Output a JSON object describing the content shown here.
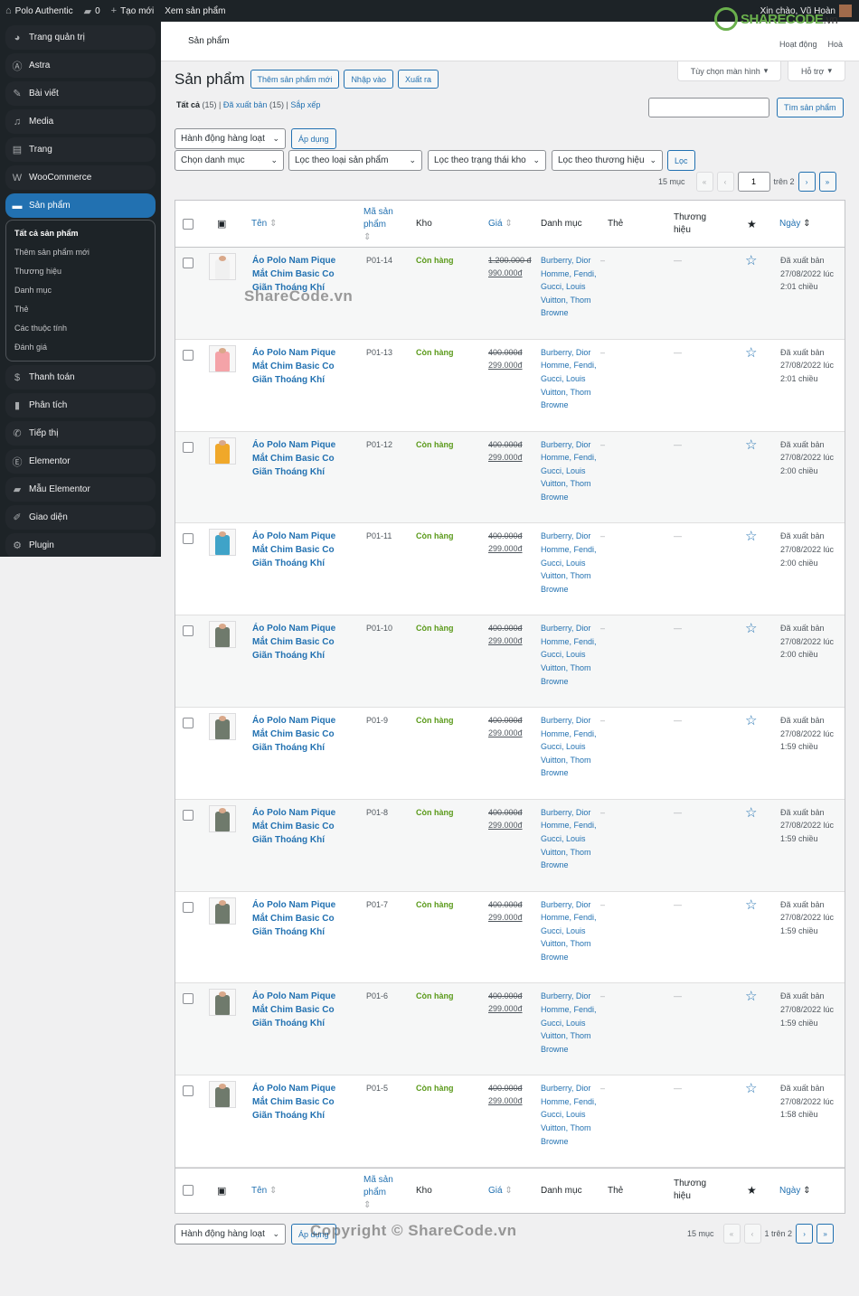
{
  "adminbar": {
    "site": "Polo Authentic",
    "comments": "0",
    "new": "Tạo mới",
    "view": "Xem sản phẩm",
    "greeting": "Xin chào, Vũ Hoàn"
  },
  "sidebar": {
    "items": [
      {
        "label": "Trang quản trị",
        "icon": "dashboard-icon",
        "g": "◕"
      },
      {
        "label": "Astra",
        "icon": "astra-icon",
        "g": "Ⓐ"
      },
      {
        "label": "Bài viết",
        "icon": "pin-icon",
        "g": "✎"
      },
      {
        "label": "Media",
        "icon": "media-icon",
        "g": "♫"
      },
      {
        "label": "Trang",
        "icon": "pages-icon",
        "g": "▤"
      },
      {
        "label": "WooCommerce",
        "icon": "woo-icon",
        "g": "W"
      },
      {
        "label": "Sản phẩm",
        "icon": "products-icon",
        "g": "▬"
      }
    ],
    "submenu": [
      "Tất cả sản phẩm",
      "Thêm sản phẩm mới",
      "Thương hiệu",
      "Danh mục",
      "Thẻ",
      "Các thuộc tính",
      "Đánh giá"
    ],
    "items2": [
      {
        "label": "Thanh toán",
        "icon": "payments-icon",
        "g": "$"
      },
      {
        "label": "Phân tích",
        "icon": "analytics-icon",
        "g": "▮"
      },
      {
        "label": "Tiếp thị",
        "icon": "megaphone-icon",
        "g": "✆"
      },
      {
        "label": "Elementor",
        "icon": "elementor-icon",
        "g": "Ⓔ"
      },
      {
        "label": "Mẫu Elementor",
        "icon": "folder-icon",
        "g": "▰"
      },
      {
        "label": "Giao diện",
        "icon": "brush-icon",
        "g": "✐"
      },
      {
        "label": "Plugin",
        "icon": "plugin-icon",
        "g": "⚙"
      }
    ]
  },
  "header": {
    "title": "Sản phẩm",
    "activity": "Hoạt động",
    "activity2": "Hoà",
    "screen_options": "Tùy chọn màn hình",
    "help": "Hỗ trợ",
    "logo": "SHARECODE",
    "logo_tld": ".vn"
  },
  "page": {
    "title": "Sản phẩm",
    "add_new": "Thêm sản phẩm mới",
    "import": "Nhập vào",
    "export": "Xuất ra",
    "views": {
      "all": "Tất cả",
      "all_count": "(15)",
      "published": "Đã xuất bản",
      "published_count": "(15)",
      "sort": "Sắp xếp"
    },
    "search_button": "Tìm sản phẩm",
    "search_value": ""
  },
  "filters": {
    "bulk": "Hành động hàng loạt",
    "apply": "Áp dụng",
    "category": "Chọn danh mục",
    "type": "Lọc theo loại sản phẩm",
    "stock": "Lọc theo trạng thái kho",
    "brand": "Lọc theo thương hiệu",
    "filter": "Lọc"
  },
  "pagination": {
    "count": "15 mục",
    "current": "1",
    "of": "trên 2",
    "first": "«",
    "prev": "‹",
    "next": "›",
    "last": "»",
    "bottom_text": "1 trên 2"
  },
  "columns": {
    "name": "Tên",
    "sku1": "Mã sản",
    "sku2": "phẩm",
    "stock": "Kho",
    "price": "Giá",
    "categories": "Danh mục",
    "tags": "Thẻ",
    "brand1": "Thương",
    "brand2": "hiệu",
    "date": "Ngày"
  },
  "products": [
    {
      "name": "Áo Polo Nam Pique Mắt Chim Basic Co Giãn Thoáng Khí",
      "sku": "P01-14",
      "stock": "Còn hàng",
      "old": "1.200.000 đ",
      "new": "990.000đ",
      "cats": "Burberry, Dior Homme, Fendi, Gucci, Louis Vuitton, Thom Browne",
      "tags": "–",
      "brand": "—",
      "status": "Đã xuất bản",
      "date": "27/08/2022 lúc 2:01 chiều",
      "color": "#f0f0f0"
    },
    {
      "name": "Áo Polo Nam Pique Mắt Chim Basic Co Giãn Thoáng Khí",
      "sku": "P01-13",
      "stock": "Còn hàng",
      "old": "400.000đ",
      "new": "299.000đ",
      "cats": "Burberry, Dior Homme, Fendi, Gucci, Louis Vuitton, Thom Browne",
      "tags": "–",
      "brand": "—",
      "status": "Đã xuất bản",
      "date": "27/08/2022 lúc 2:01 chiều",
      "color": "#f4a3a8"
    },
    {
      "name": "Áo Polo Nam Pique Mắt Chim Basic Co Giãn Thoáng Khí",
      "sku": "P01-12",
      "stock": "Còn hàng",
      "old": "400.000đ",
      "new": "299.000đ",
      "cats": "Burberry, Dior Homme, Fendi, Gucci, Louis Vuitton, Thom Browne",
      "tags": "–",
      "brand": "—",
      "status": "Đã xuất bản",
      "date": "27/08/2022 lúc 2:00 chiều",
      "color": "#f0a82a"
    },
    {
      "name": "Áo Polo Nam Pique Mắt Chim Basic Co Giãn Thoáng Khí",
      "sku": "P01-11",
      "stock": "Còn hàng",
      "old": "400.000đ",
      "new": "299.000đ",
      "cats": "Burberry, Dior Homme, Fendi, Gucci, Louis Vuitton, Thom Browne",
      "tags": "–",
      "brand": "—",
      "status": "Đã xuất bản",
      "date": "27/08/2022 lúc 2:00 chiều",
      "color": "#3fa3c8"
    },
    {
      "name": "Áo Polo Nam Pique Mắt Chim Basic Co Giãn Thoáng Khí",
      "sku": "P01-10",
      "stock": "Còn hàng",
      "old": "400.000đ",
      "new": "299.000đ",
      "cats": "Burberry, Dior Homme, Fendi, Gucci, Louis Vuitton, Thom Browne",
      "tags": "–",
      "brand": "—",
      "status": "Đã xuất bản",
      "date": "27/08/2022 lúc 2:00 chiều",
      "color": "#6f7a6c"
    },
    {
      "name": "Áo Polo Nam Pique Mắt Chim Basic Co Giãn Thoáng Khí",
      "sku": "P01-9",
      "stock": "Còn hàng",
      "old": "400.000đ",
      "new": "299.000đ",
      "cats": "Burberry, Dior Homme, Fendi, Gucci, Louis Vuitton, Thom Browne",
      "tags": "–",
      "brand": "—",
      "status": "Đã xuất bản",
      "date": "27/08/2022 lúc 1:59 chiều",
      "color": "#6f7a6c"
    },
    {
      "name": "Áo Polo Nam Pique Mắt Chim Basic Co Giãn Thoáng Khí",
      "sku": "P01-8",
      "stock": "Còn hàng",
      "old": "400.000đ",
      "new": "299.000đ",
      "cats": "Burberry, Dior Homme, Fendi, Gucci, Louis Vuitton, Thom Browne",
      "tags": "–",
      "brand": "—",
      "status": "Đã xuất bản",
      "date": "27/08/2022 lúc 1:59 chiều",
      "color": "#6f7a6c"
    },
    {
      "name": "Áo Polo Nam Pique Mắt Chim Basic Co Giãn Thoáng Khí",
      "sku": "P01-7",
      "stock": "Còn hàng",
      "old": "400.000đ",
      "new": "299.000đ",
      "cats": "Burberry, Dior Homme, Fendi, Gucci, Louis Vuitton, Thom Browne",
      "tags": "–",
      "brand": "—",
      "status": "Đã xuất bản",
      "date": "27/08/2022 lúc 1:59 chiều",
      "color": "#6f7a6c"
    },
    {
      "name": "Áo Polo Nam Pique Mắt Chim Basic Co Giãn Thoáng Khí",
      "sku": "P01-6",
      "stock": "Còn hàng",
      "old": "400.000đ",
      "new": "299.000đ",
      "cats": "Burberry, Dior Homme, Fendi, Gucci, Louis Vuitton, Thom Browne",
      "tags": "–",
      "brand": "—",
      "status": "Đã xuất bản",
      "date": "27/08/2022 lúc 1:59 chiều",
      "color": "#6f7a6c"
    },
    {
      "name": "Áo Polo Nam Pique Mắt Chim Basic Co Giãn Thoáng Khí",
      "sku": "P01-5",
      "stock": "Còn hàng",
      "old": "400.000đ",
      "new": "299.000đ",
      "cats": "Burberry, Dior Homme, Fendi, Gucci, Louis Vuitton, Thom Browne",
      "tags": "–",
      "brand": "—",
      "status": "Đã xuất bản",
      "date": "27/08/2022 lúc 1:58 chiều",
      "color": "#6f7a6c"
    }
  ],
  "watermarks": {
    "top": "ShareCode.vn",
    "bottom": "Copyright © ShareCode.vn"
  }
}
